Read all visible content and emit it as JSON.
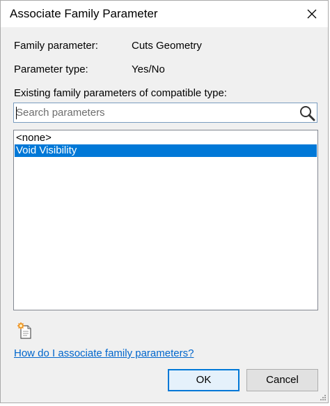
{
  "dialog": {
    "title": "Associate Family Parameter",
    "close_icon": "close-icon"
  },
  "info": {
    "family_parameter_label": "Family parameter:",
    "family_parameter_value": "Cuts Geometry",
    "parameter_type_label": "Parameter type:",
    "parameter_type_value": "Yes/No"
  },
  "existing": {
    "label": "Existing family parameters of compatible type:",
    "search_placeholder": "Search parameters",
    "search_value": "",
    "search_icon": "magnifier-icon",
    "items": [
      {
        "label": "<none>",
        "selected": false
      },
      {
        "label": "Void Visibility",
        "selected": true
      }
    ]
  },
  "actions": {
    "new_parameter_icon": "new-parameter-icon",
    "help_link": "How do I associate family parameters?",
    "ok_label": "OK",
    "cancel_label": "Cancel"
  },
  "colors": {
    "selection": "#0078d7",
    "link": "#0066cc",
    "dialog_bg": "#f0f0f0"
  }
}
